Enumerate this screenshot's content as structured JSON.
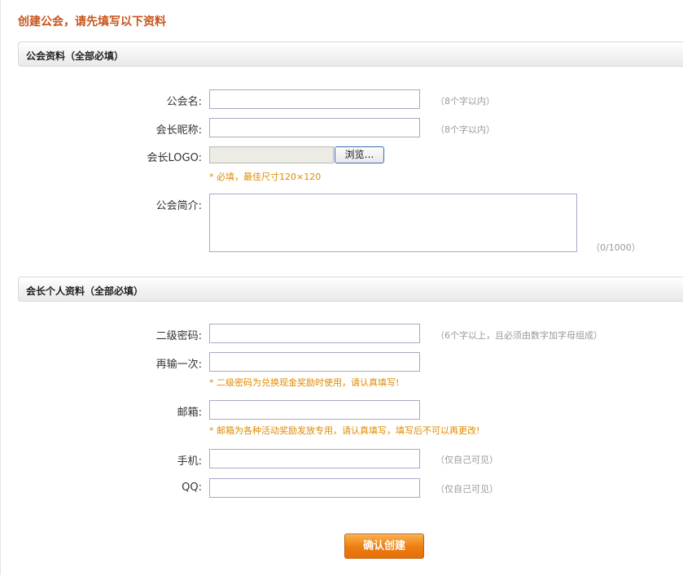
{
  "page": {
    "title": "创建公会，请先填写以下资料"
  },
  "section1": {
    "header": "公会资料（全部必填）",
    "guild_name": {
      "label": "公会名:",
      "value": "",
      "hint": "（8个字以内）"
    },
    "leader_nickname": {
      "label": "会长昵称:",
      "value": "",
      "hint": "（8个字以内）"
    },
    "leader_logo": {
      "label": "会长LOGO:",
      "browse_label": "浏览…",
      "note": "* 必填，最佳尺寸120×120"
    },
    "guild_intro": {
      "label": "公会简介:",
      "value": "",
      "counter": "（0/1000）"
    }
  },
  "section2": {
    "header": "会长个人资料（全部必填）",
    "second_password": {
      "label": "二级密码:",
      "value": "",
      "hint": "（6个字以上，且必须由数字加字母组成）"
    },
    "repeat_password": {
      "label": "再输一次:",
      "value": "",
      "note": "* 二级密码为兑换现金奖励时使用，请认真填写!"
    },
    "email": {
      "label": "邮箱:",
      "value": "",
      "note": "* 邮箱为各种活动奖励发放专用，请认真填写，填写后不可以再更改!"
    },
    "phone": {
      "label": "手机:",
      "value": "",
      "hint": "（仅自己可见）"
    },
    "qq": {
      "label": "QQ:",
      "value": "",
      "hint": "（仅自己可见）"
    }
  },
  "submit": {
    "label": "确认创建"
  },
  "colors": {
    "title": "#c6551b",
    "note": "#e08a00",
    "button": "#ee7d10"
  }
}
